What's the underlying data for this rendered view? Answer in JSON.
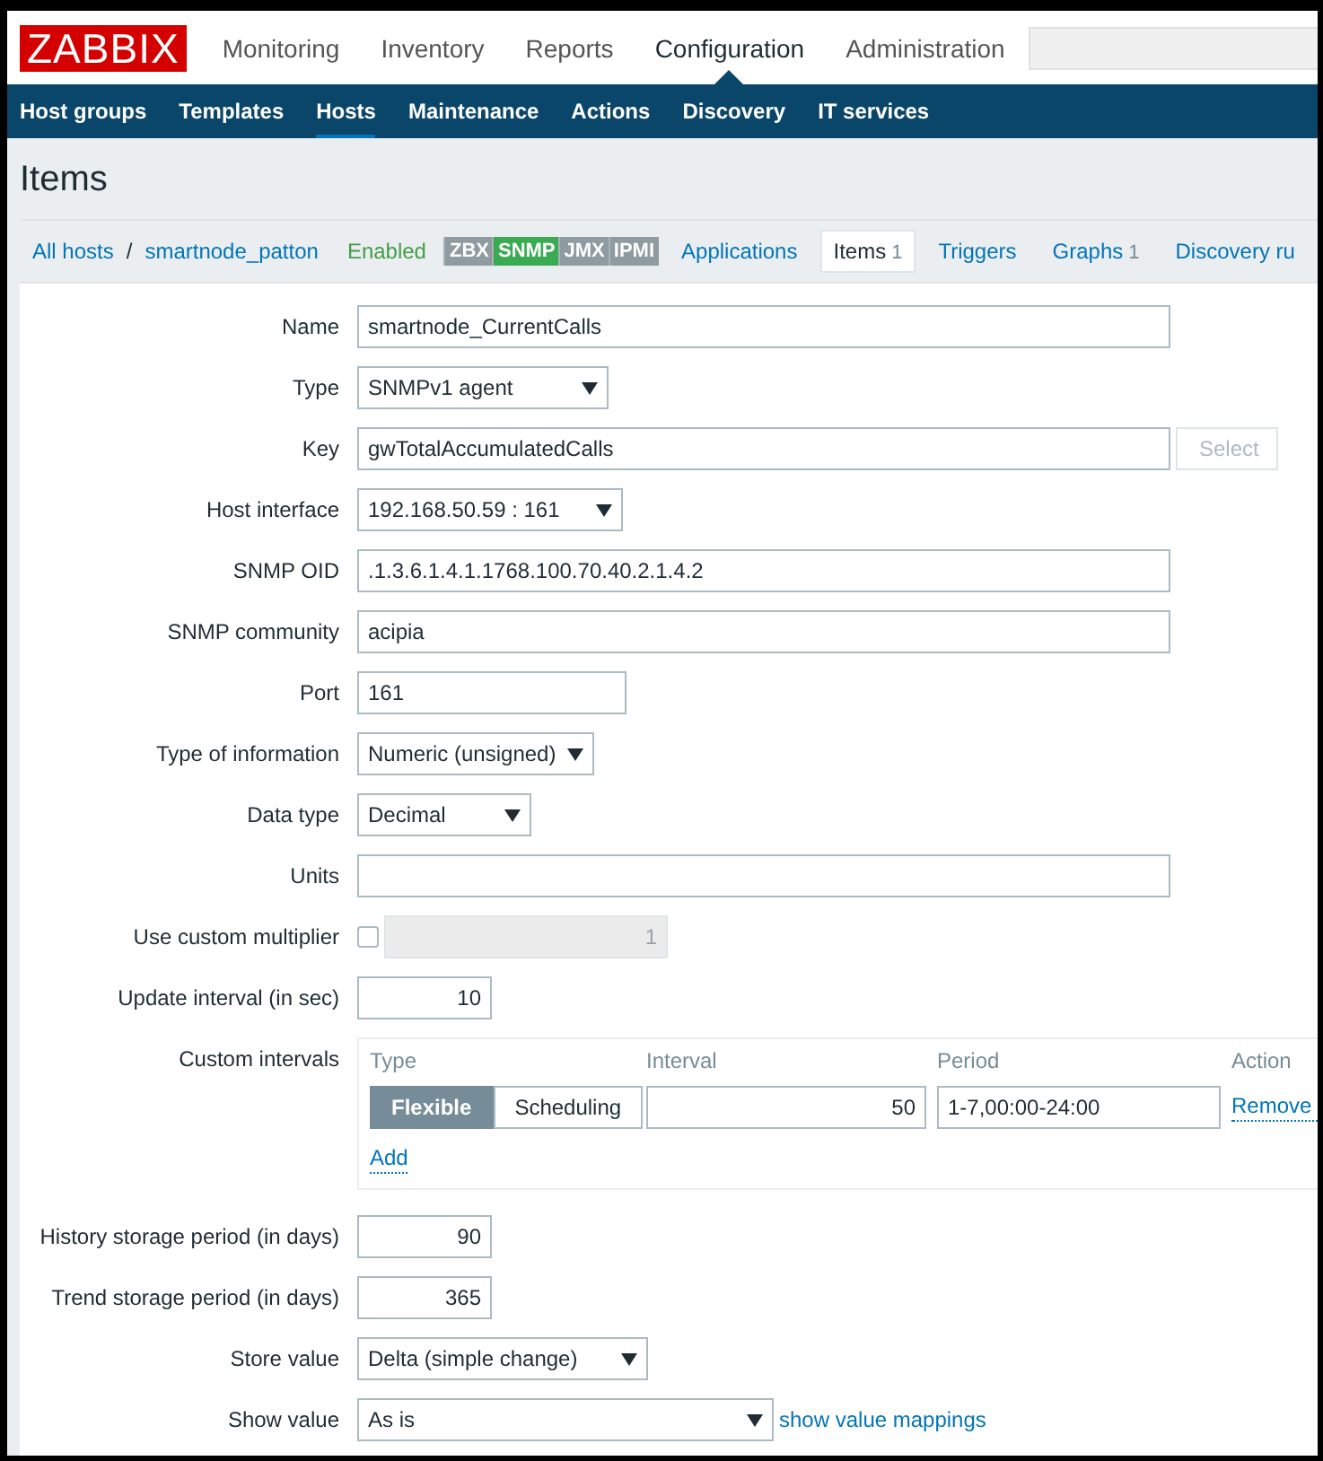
{
  "header": {
    "logo": "ZABBIX",
    "menu": [
      {
        "label": "Monitoring",
        "selected": false
      },
      {
        "label": "Inventory",
        "selected": false
      },
      {
        "label": "Reports",
        "selected": false
      },
      {
        "label": "Configuration",
        "selected": true
      },
      {
        "label": "Administration",
        "selected": false
      }
    ]
  },
  "subnav": [
    {
      "label": "Host groups",
      "selected": false
    },
    {
      "label": "Templates",
      "selected": false
    },
    {
      "label": "Hosts",
      "selected": true
    },
    {
      "label": "Maintenance",
      "selected": false
    },
    {
      "label": "Actions",
      "selected": false
    },
    {
      "label": "Discovery",
      "selected": false
    },
    {
      "label": "IT services",
      "selected": false
    }
  ],
  "page_title": "Items",
  "breadcrumb": {
    "links": [
      "All hosts",
      "smartnode_patton"
    ],
    "separator": "/",
    "status": "Enabled",
    "interfaces": [
      {
        "label": "ZBX",
        "on": false
      },
      {
        "label": "SNMP",
        "on": true
      },
      {
        "label": "JMX",
        "on": false
      },
      {
        "label": "IPMI",
        "on": false
      }
    ],
    "tabs": [
      {
        "label": "Applications",
        "selected": false
      },
      {
        "label": "Items",
        "count": "1",
        "selected": true
      },
      {
        "label": "Triggers",
        "selected": false
      },
      {
        "label": "Graphs",
        "count": "1",
        "selected": false
      },
      {
        "label": "Discovery ru",
        "selected": false
      }
    ]
  },
  "form": {
    "fields": [
      {
        "label": "Name",
        "kind": "text",
        "value": "smartnode_CurrentCalls"
      },
      {
        "label": "Type",
        "kind": "select",
        "value": "SNMPv1 agent"
      },
      {
        "label": "Key",
        "kind": "text_button",
        "value": "gwTotalAccumulatedCalls",
        "button": "Select",
        "button_disabled": true
      },
      {
        "label": "Host interface",
        "kind": "select",
        "value": "192.168.50.59 : 161"
      },
      {
        "label": "SNMP OID",
        "kind": "text",
        "value": ".1.3.6.1.4.1.1768.100.70.40.2.1.4.2"
      },
      {
        "label": "SNMP community",
        "kind": "text",
        "value": "acipia"
      },
      {
        "label": "Port",
        "kind": "text",
        "value": "161"
      },
      {
        "label": "Type of information",
        "kind": "select",
        "value": "Numeric (unsigned)"
      },
      {
        "label": "Data type",
        "kind": "select",
        "value": "Decimal"
      },
      {
        "label": "Units",
        "kind": "text"
      },
      {
        "label": "Use custom multiplier",
        "kind": "checkbox_number",
        "checked": false,
        "value": "1",
        "disabled": true
      },
      {
        "label": "Update interval (in sec)",
        "kind": "number",
        "value": "10"
      },
      {
        "label": "Custom intervals",
        "kind": "intervals",
        "columns": [
          "Type",
          "Interval",
          "Period",
          "Action"
        ],
        "rows": [
          {
            "modes": [
              {
                "label": "Flexible",
                "selected": true
              },
              {
                "label": "Scheduling",
                "selected": false
              }
            ],
            "interval": "50",
            "period": "1-7,00:00-24:00",
            "action": "Remove"
          }
        ],
        "add": "Add"
      },
      {
        "label": "History storage period (in days)",
        "kind": "number",
        "value": "90"
      },
      {
        "label": "Trend storage period (in days)",
        "kind": "number",
        "value": "365"
      },
      {
        "label": "Store value",
        "kind": "select",
        "value": "Delta (simple change)"
      },
      {
        "label": "Show value",
        "kind": "select_link",
        "value": "As is",
        "link": "show value mappings"
      }
    ]
  }
}
